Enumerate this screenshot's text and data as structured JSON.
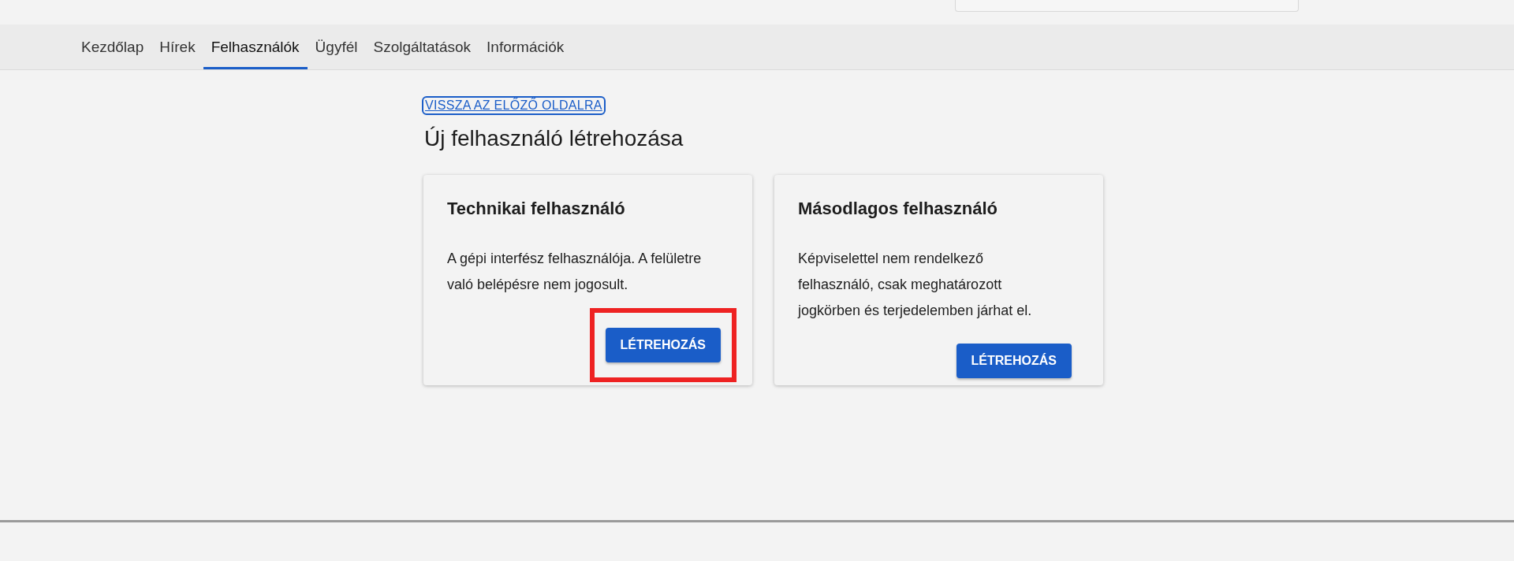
{
  "tabs": [
    {
      "label": "Kezdőlap",
      "selected": false
    },
    {
      "label": "Hírek",
      "selected": false
    },
    {
      "label": "Felhasználók",
      "selected": true
    },
    {
      "label": "Ügyfél",
      "selected": false
    },
    {
      "label": "Szolgáltatások",
      "selected": false
    },
    {
      "label": "Információk",
      "selected": false
    }
  ],
  "back_link": "VISSZA AZ ELŐZŐ OLDALRA",
  "title": "Új felhasználó létrehozása",
  "cards": [
    {
      "title": "Technikai felhasználó",
      "description": "A gépi interfész felhasználója. A felületre való belépésre nem jogosult.",
      "button": "LÉTREHOZÁS",
      "highlighted": true
    },
    {
      "title": "Másodlagos felhasználó",
      "description": "Képviselettel nem rendelkező felhasználó, csak meghatározott jogkörben és terjedelemben járhat el.",
      "button": "LÉTREHOZÁS",
      "highlighted": false
    }
  ]
}
